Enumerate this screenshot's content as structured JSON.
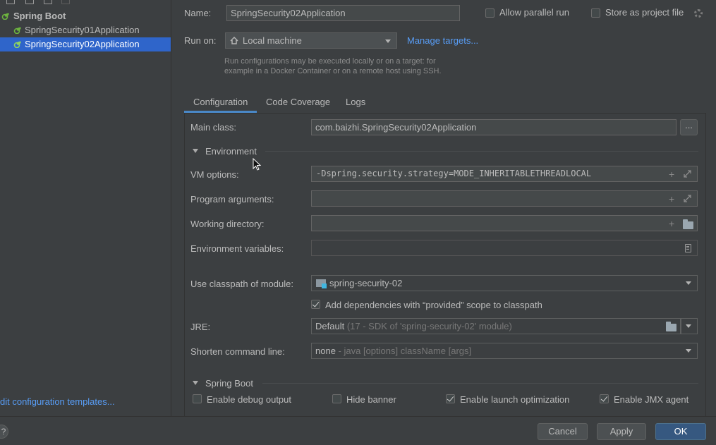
{
  "tree": {
    "group_label": "Spring Boot",
    "items": [
      {
        "label": "SpringSecurity01Application"
      },
      {
        "label": "SpringSecurity02Application"
      }
    ],
    "templates_link": "dit configuration templates..."
  },
  "header": {
    "name_label": "Name:",
    "name_value": "SpringSecurity02Application",
    "allow_parallel_label": "Allow parallel run",
    "allow_parallel_checked": false,
    "store_project_label": "Store as project file",
    "store_project_checked": false,
    "run_on_label": "Run on:",
    "run_on_value": "Local machine",
    "manage_targets": "Manage targets...",
    "run_on_hint_1": "Run configurations may be executed locally or on a target: for",
    "run_on_hint_2": "example in a Docker Container or on a remote host using SSH."
  },
  "tabs": [
    {
      "label": "Configuration",
      "active": true
    },
    {
      "label": "Code Coverage",
      "active": false
    },
    {
      "label": "Logs",
      "active": false
    }
  ],
  "config": {
    "main_class_label": "Main class:",
    "main_class_value": "com.baizhi.SpringSecurity02Application",
    "browse_label": "...",
    "environment_section": "Environment",
    "vm_options_label": "VM options:",
    "vm_options_value": "-Dspring.security.strategy=MODE_INHERITABLETHREADLOCAL",
    "program_args_label": "Program arguments:",
    "program_args_value": "",
    "working_dir_label": "Working directory:",
    "working_dir_value": "",
    "env_vars_label": "Environment variables:",
    "env_vars_value": "",
    "classpath_label": "Use classpath of module:",
    "classpath_value": "spring-security-02",
    "add_deps_label": "Add dependencies with “provided” scope to classpath",
    "add_deps_checked": true,
    "jre_label": "JRE:",
    "jre_value": "Default",
    "jre_hint": "(17 - SDK of 'spring-security-02' module)",
    "shorten_label": "Shorten command line:",
    "shorten_value": "none",
    "shorten_hint": "- java [options] className [args]"
  },
  "spring_boot": {
    "section_label": "Spring Boot",
    "options": [
      {
        "label": "Enable debug output",
        "checked": false
      },
      {
        "label": "Hide banner",
        "checked": false
      },
      {
        "label": "Enable launch optimization",
        "checked": true
      },
      {
        "label": "Enable JMX agent",
        "checked": true
      }
    ]
  },
  "footer": {
    "help": "?",
    "cancel": "Cancel",
    "apply": "Apply",
    "ok": "OK"
  },
  "colors": {
    "background": "#3c3f41",
    "selection": "#2f65ca",
    "link": "#589df6",
    "tab_underline": "#4a88c7",
    "primary_button": "#365880",
    "spring_leaf": "#6db33f"
  }
}
